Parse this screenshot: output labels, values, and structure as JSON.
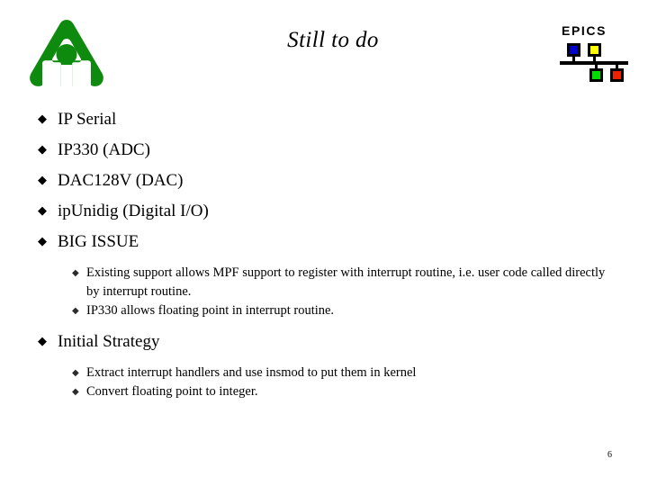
{
  "slide": {
    "title": "Still to do",
    "page_number": "6",
    "background_color": "#ffffff",
    "text_color": "#000000"
  },
  "anl_logo": {
    "name": "argonne-triangle-logo",
    "color": "#0e8b0e"
  },
  "epics_logo": {
    "wordmark": "EPICS",
    "nodes": [
      {
        "name": "node-blue",
        "color": "#0000cc"
      },
      {
        "name": "node-yellow",
        "color": "#ffff00"
      },
      {
        "name": "node-green",
        "color": "#00dd00"
      },
      {
        "name": "node-red",
        "color": "#ee2200"
      }
    ],
    "bus_color": "#000000"
  },
  "bullets": {
    "marker_level1": "◆",
    "marker_level2": "◆",
    "items": [
      {
        "level": 1,
        "text": "IP Serial"
      },
      {
        "level": 1,
        "text": "IP330 (ADC)"
      },
      {
        "level": 1,
        "text": "DAC128V (DAC)"
      },
      {
        "level": 1,
        "text": "ipUnidig (Digital I/O)"
      },
      {
        "level": 1,
        "text": "BIG ISSUE"
      },
      {
        "level": 2,
        "text": "Existing support allows MPF support to register with interrupt routine, i.e. user code called directly by interrupt routine."
      },
      {
        "level": 2,
        "text": "IP330 allows floating point in interrupt routine."
      },
      {
        "level": 1,
        "text": "Initial Strategy"
      },
      {
        "level": 2,
        "text": "Extract interrupt handlers and use insmod to put them in kernel"
      },
      {
        "level": 2,
        "text": "Convert floating point to integer."
      }
    ]
  }
}
